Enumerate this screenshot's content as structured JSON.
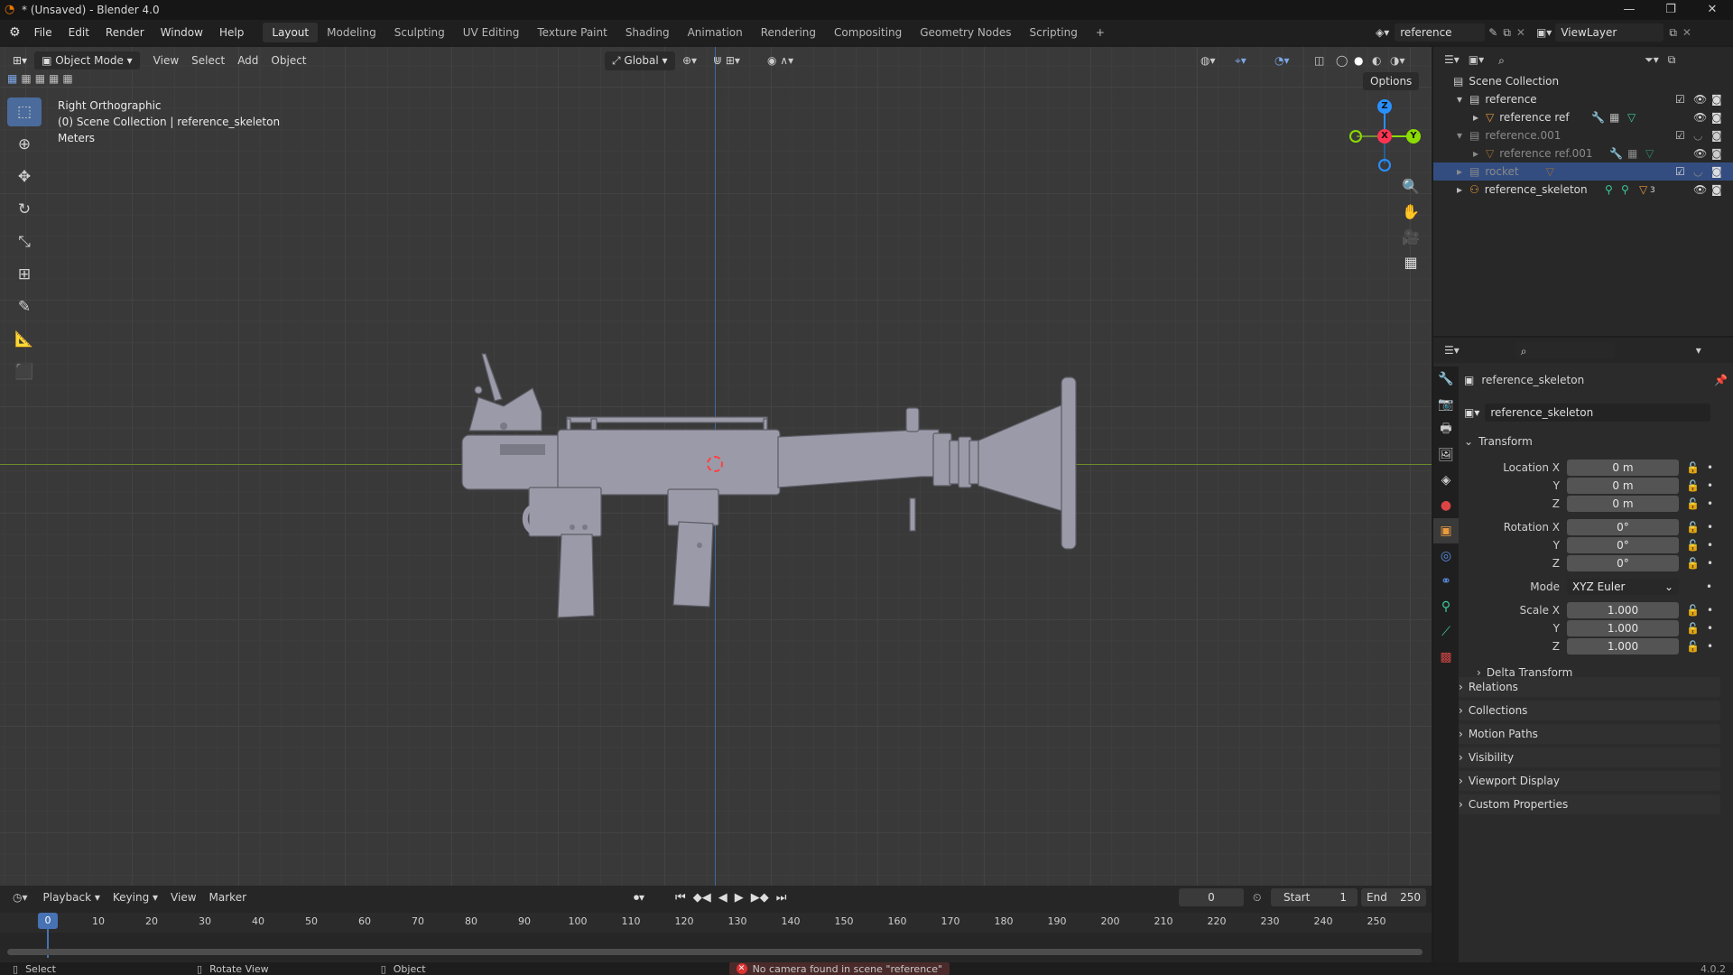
{
  "window": {
    "title": "* (Unsaved) - Blender 4.0",
    "min": "—",
    "max": "❐",
    "close": "✕"
  },
  "menu": [
    "File",
    "Edit",
    "Render",
    "Window",
    "Help"
  ],
  "workspaces": {
    "active": "Layout",
    "items": [
      "Modeling",
      "Sculpting",
      "UV Editing",
      "Texture Paint",
      "Shading",
      "Animation",
      "Rendering",
      "Compositing",
      "Geometry Nodes",
      "Scripting",
      "+"
    ]
  },
  "scene_selector": {
    "value": "reference"
  },
  "viewlayer": {
    "value": "ViewLayer"
  },
  "viewport": {
    "mode": "Object Mode",
    "menus": [
      "View",
      "Select",
      "Add",
      "Object"
    ],
    "orientation": "Global",
    "options_label": "Options",
    "info": {
      "view": "Right Orthographic",
      "collection": "(0) Scene Collection | reference_skeleton",
      "units": "Meters"
    },
    "gizmo": {
      "z": "Z",
      "x": "X",
      "y": "Y"
    }
  },
  "outliner": {
    "root": "Scene Collection",
    "rows": [
      {
        "label": "reference"
      },
      {
        "label": "reference ref"
      },
      {
        "label": "reference.001"
      },
      {
        "label": "reference ref.001"
      },
      {
        "label": "rocket"
      },
      {
        "label": "reference_skeleton"
      }
    ],
    "skeleton_count": "3"
  },
  "properties": {
    "object_name": "reference_skeleton",
    "data_name": "reference_skeleton",
    "transform_title": "Transform",
    "location": {
      "label": "Location X",
      "x": "0 m",
      "y": "0 m",
      "z": "0 m"
    },
    "rotation": {
      "label": "Rotation X",
      "x": "0°",
      "y": "0°",
      "z": "0°"
    },
    "mode": {
      "label": "Mode",
      "value": "XYZ Euler"
    },
    "scale": {
      "label": "Scale X",
      "x": "1.000",
      "y": "1.000",
      "z": "1.000"
    },
    "axis_y": "Y",
    "axis_z": "Z",
    "panels": [
      "Delta Transform",
      "Relations",
      "Collections",
      "Motion Paths",
      "Visibility",
      "Viewport Display",
      "Custom Properties"
    ]
  },
  "timeline": {
    "menus": [
      "Playback",
      "Keying",
      "View",
      "Marker"
    ],
    "current_frame": "0",
    "start_label": "Start",
    "start": "1",
    "end_label": "End",
    "end": "250",
    "ticks": [
      "0",
      "10",
      "20",
      "30",
      "40",
      "50",
      "60",
      "70",
      "80",
      "90",
      "100",
      "110",
      "120",
      "130",
      "140",
      "150",
      "160",
      "170",
      "180",
      "190",
      "200",
      "210",
      "220",
      "230",
      "240",
      "250"
    ]
  },
  "status": {
    "select": "Select",
    "rotate": "Rotate View",
    "object": "Object",
    "error": "No camera found in scene \"reference\"",
    "version": "4.0.2"
  },
  "colors": {
    "accent": "#4772b3",
    "selected_row": "#334d80",
    "x_axis": "#ff3352",
    "y_axis": "#8bdc00",
    "z_axis": "#2890ff",
    "mesh": "#9a9aa8"
  }
}
